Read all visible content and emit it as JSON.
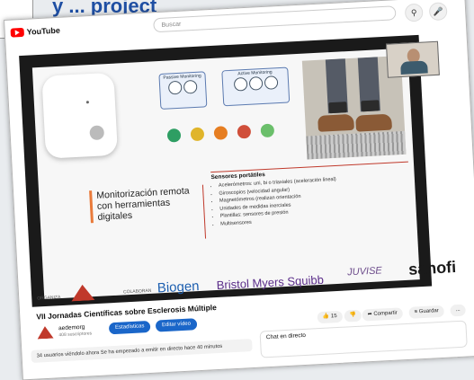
{
  "caption": {
    "text": "y ... project"
  },
  "app": {
    "logo_label": "YouTube"
  },
  "search": {
    "placeholder": "Buscar"
  },
  "slide": {
    "diagram_left_title": "Passive Monitoring",
    "diagram_right_title": "Active Monitoring",
    "monitor_title": "Monitorización remota con herramientas digitales",
    "sensors_title": "Sensores portátiles",
    "sensors_items": [
      "Acelerómetros: uni, bi o triaxiales (aceleración lineal)",
      "Giroscopios (velocidad angular)",
      "Magnetómetros (realizan orientación",
      "Unidades de medidas inerciales",
      "Plantillas: sensores de presión",
      "Multisensores"
    ],
    "sponsors": {
      "organiza": "ORGANIZA",
      "colaboran": "COLABORAN",
      "biogen": "Biogen",
      "bms": "Bristol Myers Squibb",
      "juvise": "JUVISE",
      "sanofi": "sanofi"
    }
  },
  "video": {
    "title": "VII Jornadas Científicas sobre Esclerosis Múltiple",
    "channel": "aedemorg",
    "subscribers": "408 suscriptores",
    "stats_button": "Estadísticas",
    "edit_button": "Editar vídeo",
    "likes": "15",
    "share": "Compartir",
    "save": "Guardar",
    "more": "...",
    "description": "34 usuarios viéndolo ahora  Se ha empezado a emitir en directo hace 40 minutos",
    "chat_title": "Chat en directo"
  },
  "colors": {
    "brand": "#ff0000",
    "accent": "#1a66c9",
    "slide_accent": "#c0392b"
  }
}
